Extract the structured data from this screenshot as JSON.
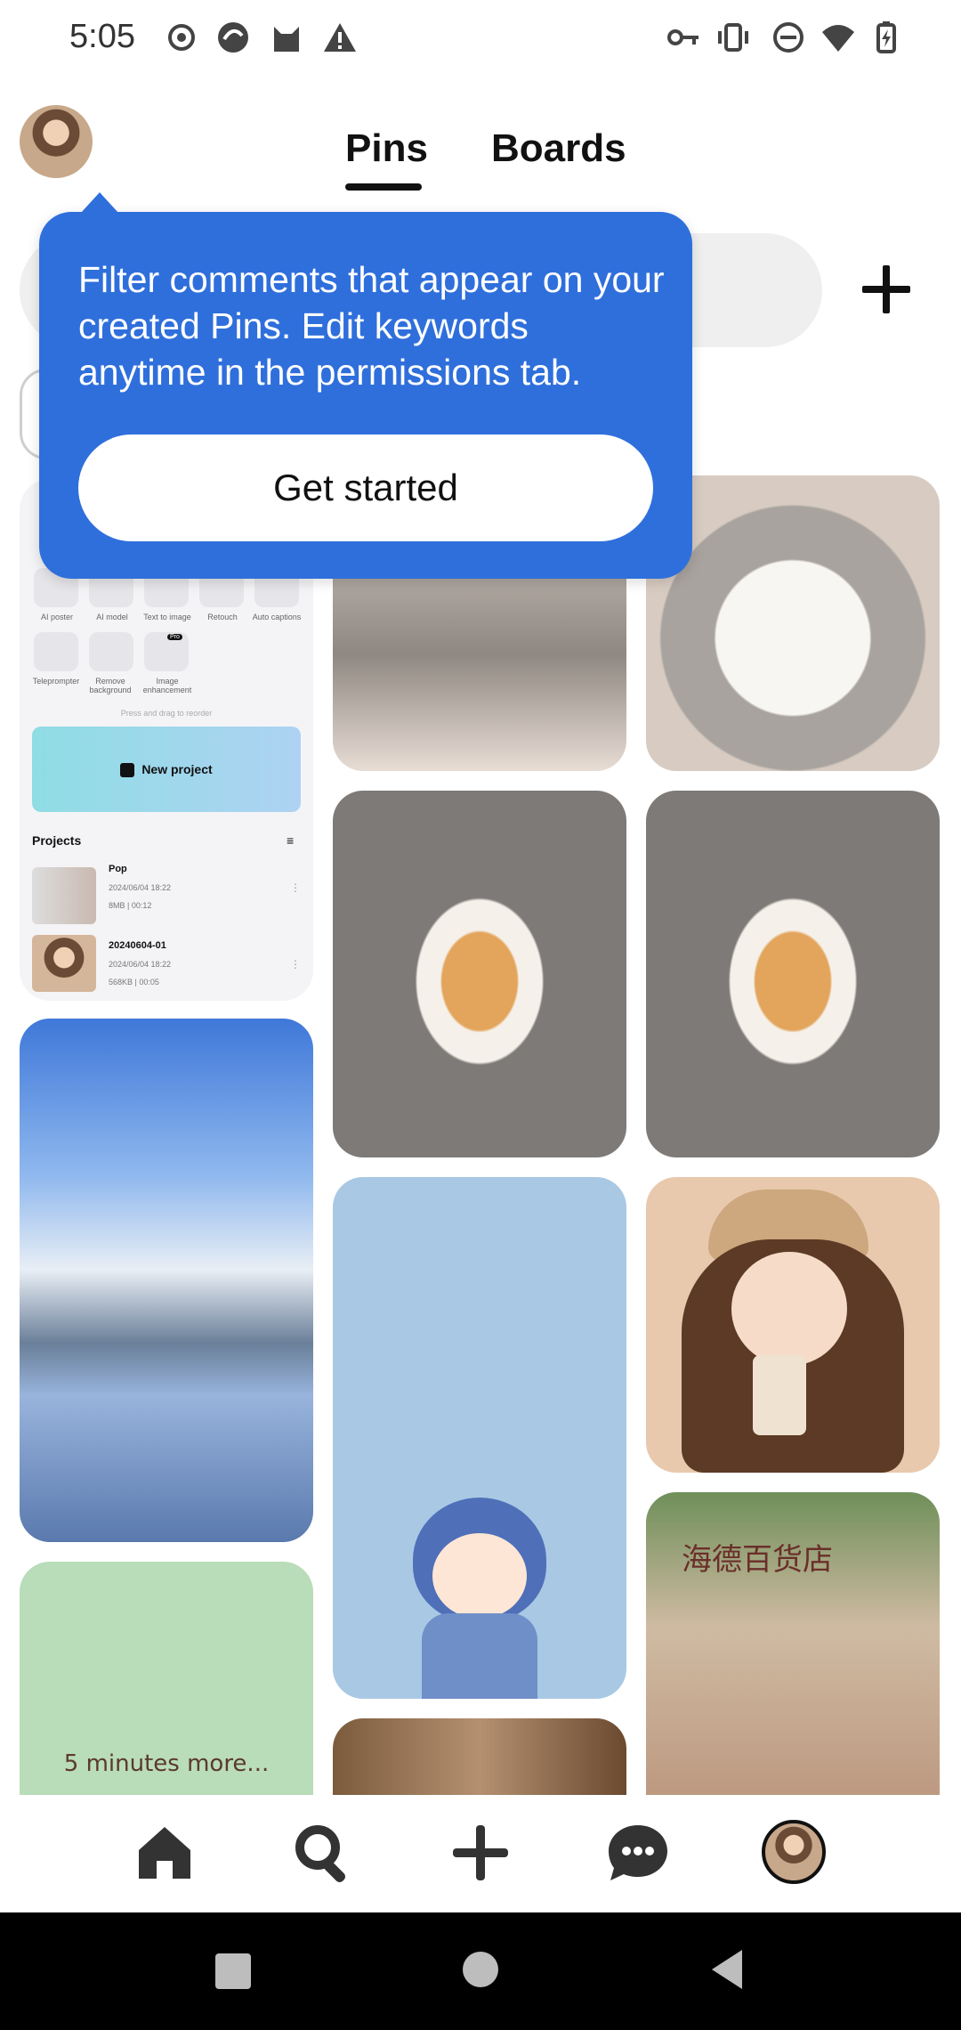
{
  "status_bar": {
    "time": "5:05"
  },
  "header": {
    "tabs": [
      {
        "label": "Pins",
        "selected": true
      },
      {
        "label": "Boards",
        "selected": false
      }
    ]
  },
  "tooltip": {
    "message": "Filter comments that appear on your created Pins. Edit keywords anytime in the permissions tab.",
    "button_label": "Get started"
  },
  "pins": {
    "app_screenshot": {
      "tools_row1": [
        "AI poster",
        "AI model",
        "Text to image",
        "Retouch",
        "Auto captions"
      ],
      "tools_row2": [
        "Teleprompter",
        "Remove background",
        "Image enhancement"
      ],
      "pro_badge": "Pro",
      "reorder_hint": "Press and drag to reorder",
      "new_project_label": "New project",
      "projects_label": "Projects",
      "projects": [
        {
          "name": "Pop",
          "date": "2024/06/04 18:22",
          "meta": "8MB | 00:12"
        },
        {
          "name": "20240604-01",
          "date": "2024/06/04 18:22",
          "meta": "568KB | 00:05"
        }
      ]
    },
    "green_card_text": "5 minutes more...",
    "shop_sign": "海德百货店"
  },
  "colors": {
    "tooltip_bg": "#2f6fdc",
    "search_bg": "#efefef"
  }
}
